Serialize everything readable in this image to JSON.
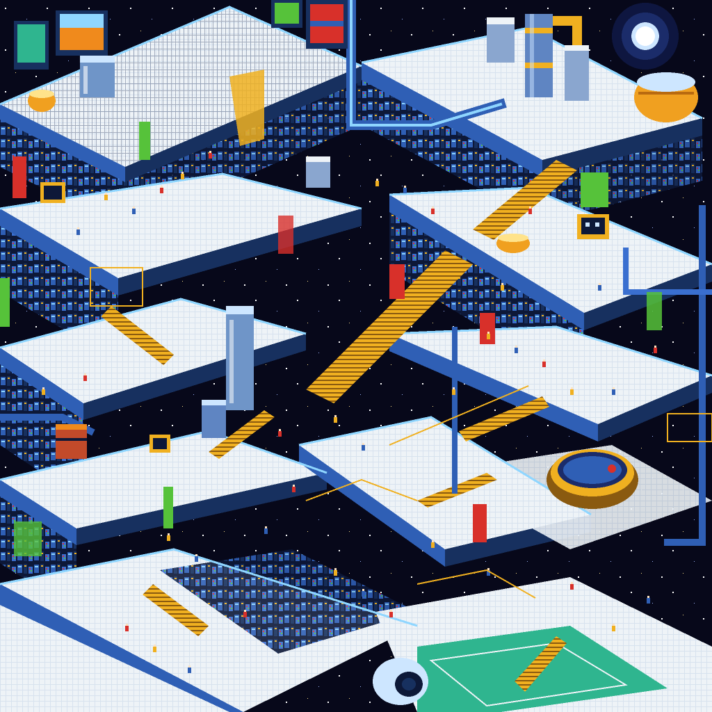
{
  "scene": {
    "type": "isometric pixel-art industrial complex",
    "palette": {
      "space": "#07081a",
      "floor": "#eef3f7",
      "floor_shadow": "#c9d6e6",
      "wall_blue": "#2f5fb5",
      "wall_dark": "#17305f",
      "wall_deep": "#0d1838",
      "edge_cyan": "#8fd6ff",
      "rail_yellow": "#f0b020",
      "accent_orange": "#f08a1c",
      "accent_red": "#d8302a",
      "accent_green": "#56c23a",
      "accent_teal": "#2fb58f",
      "glow": "#ffe38a",
      "sky_star": "#ffffff"
    },
    "icons": [
      "moon-icon",
      "star-icon",
      "tank-icon",
      "pipe-icon",
      "stair-icon",
      "monitor-icon",
      "worker-icon",
      "reactor-icon",
      "radar-dish-icon"
    ],
    "stairs_count_visible": 9,
    "levels_visible": 6
  }
}
